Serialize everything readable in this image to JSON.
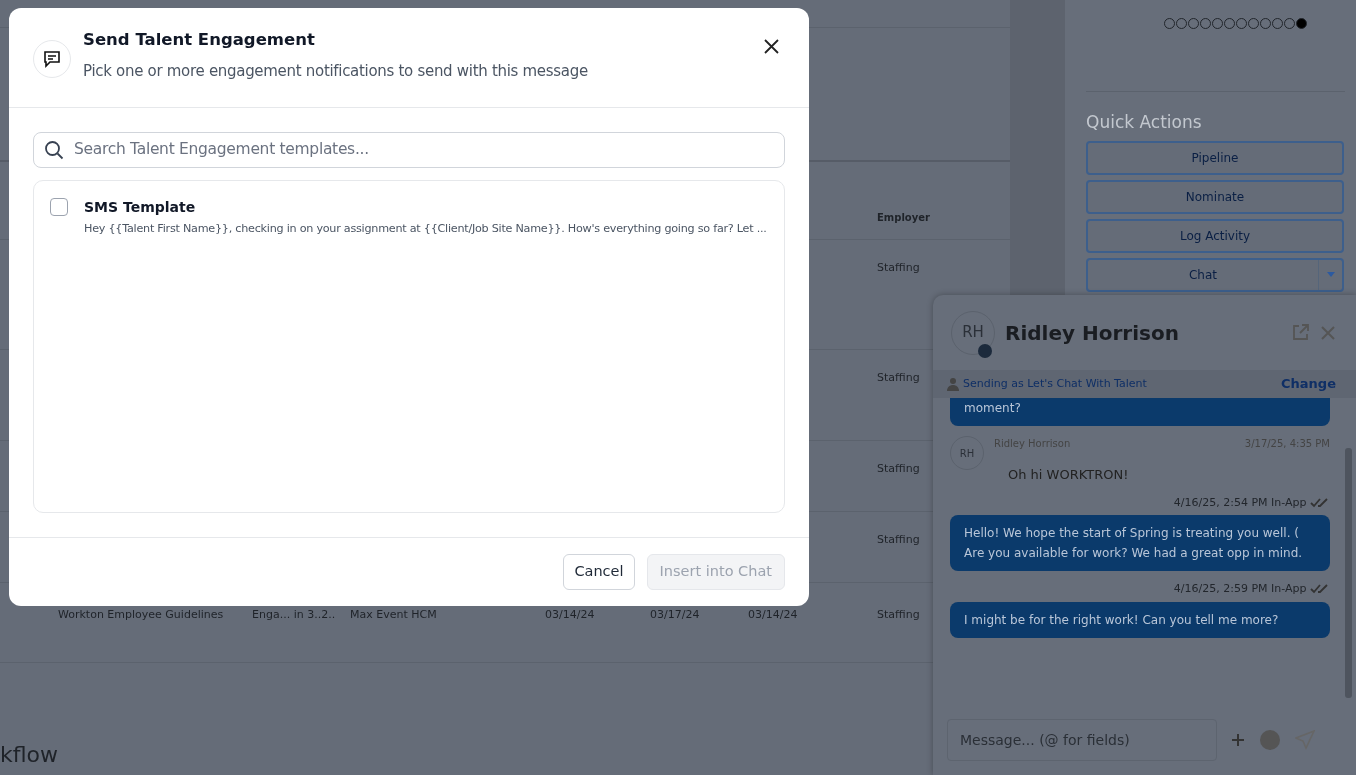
{
  "background": {
    "table": {
      "header": "Employer",
      "rows": [
        {
          "employer": "Staffing"
        },
        {
          "employer": "Staffing"
        },
        {
          "employer": "Staffing"
        },
        {
          "employer": "Staffing"
        },
        {
          "column_1": "Workton Employee Guidelines",
          "column_2": "Enga... in 3..2..",
          "column_3": "Max Event HCM",
          "column_4": "03/14/24",
          "column_5": "03/17/24",
          "column_6": "03/14/24",
          "employer": "Staffing"
        }
      ]
    },
    "section_title": "kflow",
    "carousel_dots": [
      {
        "selected": false
      },
      {
        "selected": false
      },
      {
        "selected": false
      },
      {
        "selected": false
      },
      {
        "selected": false
      },
      {
        "selected": false
      },
      {
        "selected": false
      },
      {
        "selected": false
      },
      {
        "selected": false
      },
      {
        "selected": false
      },
      {
        "selected": false
      },
      {
        "selected": true
      }
    ],
    "quick_actions": {
      "title": "Quick Actions",
      "buttons": [
        {
          "label": "Pipeline",
          "kind": "button"
        },
        {
          "label": "Nominate",
          "kind": "button"
        },
        {
          "label": "Log Activity",
          "kind": "button"
        },
        {
          "label": "Chat",
          "kind": "split"
        }
      ]
    },
    "chat": {
      "initials": "RH",
      "name": "Ridley Horrison",
      "sending_as": "Sending as Let's Chat With Talent",
      "change": "Change",
      "messages": [
        {
          "kind": "outgoing",
          "text": "moment?"
        },
        {
          "kind": "incoming",
          "initials": "RH",
          "sender": "Ridley Horrison",
          "time": "3/17/25, 4:35 PM",
          "text": "Oh hi WORKTRON!"
        },
        {
          "kind": "outgoing",
          "meta": "4/16/25, 2:54 PM In-App",
          "text": "Hello! We hope the start of Spring is treating you well. ( Are you available for work? We had a great opp in mind."
        },
        {
          "kind": "outgoing",
          "meta": "4/16/25, 2:59 PM In-App",
          "text": "I might be for the right work! Can you tell me more?"
        }
      ],
      "composer": {
        "placeholder": "Message... (@ for fields)"
      }
    }
  },
  "modal": {
    "title": "Send Talent Engagement",
    "subtitle": "Pick one or more engagement notifications to send with this message",
    "search": {
      "placeholder": "Search Talent Engagement templates..."
    },
    "templates": [
      {
        "title": "SMS Template",
        "body": "Hey {{Talent First Name}}, checking in on your assignment at {{Client/Job Site Name}}. How's everything going so far? Let ...",
        "checked": false
      }
    ],
    "cancel": {
      "label": "Cancel"
    },
    "insert": {
      "label": "Insert into Chat",
      "disabled": true
    }
  }
}
